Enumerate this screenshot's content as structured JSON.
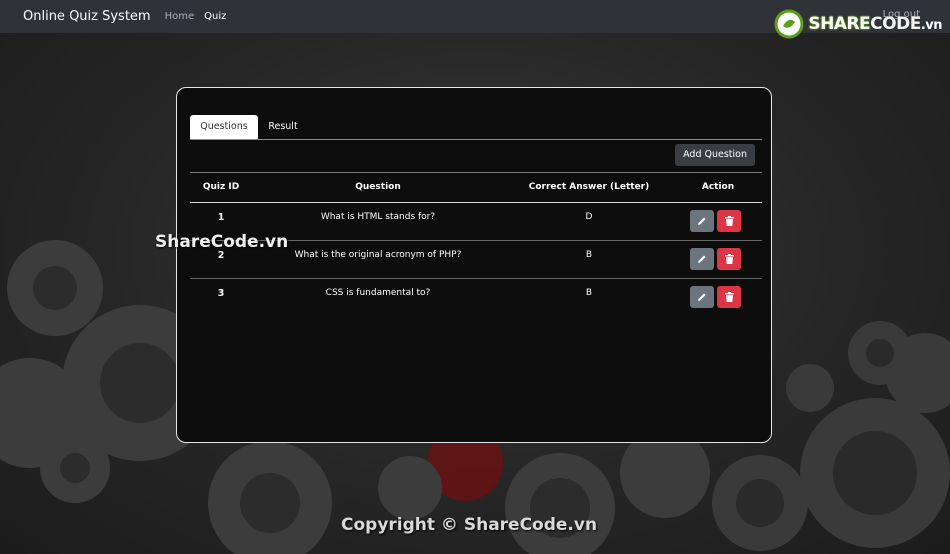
{
  "navbar": {
    "brand": "Online Quiz System",
    "links": [
      {
        "label": "Home"
      },
      {
        "label": "Quiz"
      }
    ],
    "logout": "Log out"
  },
  "watermark": {
    "logo_share": "SHARE",
    "logo_code": "CODE",
    "logo_vn": ".vn",
    "center": "ShareCode.vn",
    "footer": "Copyright © ShareCode.vn"
  },
  "tabs": [
    {
      "label": "Questions",
      "active": true
    },
    {
      "label": "Result",
      "active": false
    }
  ],
  "toolbar": {
    "add_label": "Add Question"
  },
  "table": {
    "headers": [
      "Quiz ID",
      "Question",
      "Correct Answer (Letter)",
      "Action"
    ],
    "rows": [
      {
        "id": "1",
        "question": "What is HTML stands for?",
        "answer": "D"
      },
      {
        "id": "2",
        "question": "What is the original acronym of PHP?",
        "answer": "B"
      },
      {
        "id": "3",
        "question": "CSS is fundamental to?",
        "answer": "B"
      }
    ]
  },
  "icons": {
    "edit": "pencil-icon",
    "delete": "trash-icon"
  },
  "colors": {
    "edit_button": "#6c757d",
    "delete_button": "#dc3545",
    "navbar": "#2f3237"
  }
}
